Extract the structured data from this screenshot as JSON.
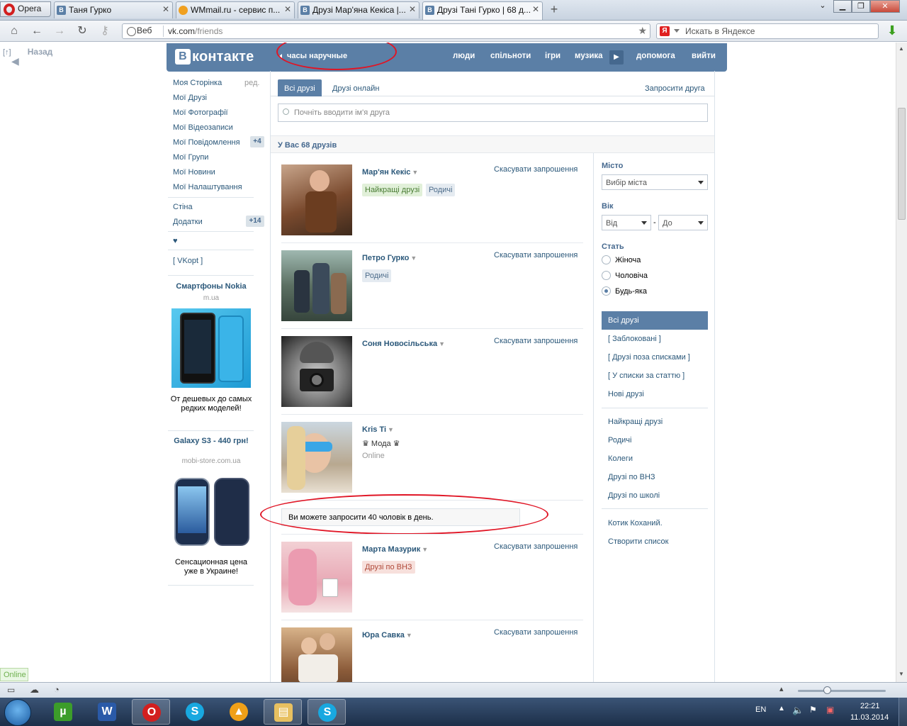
{
  "browser": {
    "menu_label": "Opera",
    "tabs": [
      {
        "title": "Таня Гурко",
        "favicon": "В"
      },
      {
        "title": "WMmail.ru - сервис п...",
        "favicon": "W"
      },
      {
        "title": "Друзі Мар'яна Кекіса |...",
        "favicon": "В"
      },
      {
        "title": "Друзі Тані Гурко | 68 д...",
        "favicon": "В"
      }
    ],
    "new_tab": "+",
    "address": {
      "mode": "Веб",
      "domain": "vk.com",
      "path": "/friends"
    },
    "search_placeholder": "Искать в Яндексе",
    "yandex": "Я",
    "status_online": "Online"
  },
  "page": {
    "back_link": "Назад",
    "back_icon": "[↑]",
    "header": {
      "logo_box": "В",
      "logo_text": "контакте",
      "status": "часы наручные",
      "nav": [
        "люди",
        "спільноти",
        "ігри",
        "музика",
        "допомога",
        "вийти"
      ]
    },
    "left_menu": {
      "items": [
        "Моя Сторінка",
        "Мої Друзі",
        "Мої Фотографії",
        "Мої Відеозаписи",
        "Мої Повідомлення",
        "Мої Групи",
        "Мої Новини",
        "Мої Налаштування"
      ],
      "edit_label": "ред.",
      "messages_badge": "+4",
      "items2": [
        "Стіна",
        "Додатки"
      ],
      "apps_badge": "+14",
      "heart": "♥",
      "vkopt": "[ VKopt ]"
    },
    "ads": [
      {
        "title": "Смартфоны Nokia",
        "domain": "m.ua",
        "text": "От дешевых до самых редких моделей!"
      },
      {
        "title": "Galaxy S3 - 440 грн!",
        "domain": "mobi-store.com.ua",
        "text": "Сенсационная цена уже в Украине!"
      }
    ],
    "friends": {
      "tabs": {
        "all": "Всі друзі",
        "online": "Друзі онлайн",
        "invite": "Запросити друга"
      },
      "search_placeholder": "Почніть вводити ім'я друга",
      "count_label": "У Вас 68 друзів",
      "cancel_label": "Скасувати запрошення",
      "list": [
        {
          "name": "Мар'ян Кекіс",
          "tags": [
            "Найкращі друзі",
            "Родичі"
          ]
        },
        {
          "name": "Петро Гурко",
          "tags": [
            "Родичі"
          ]
        },
        {
          "name": "Соня Новосільська",
          "tags": []
        },
        {
          "name": "Kris Ti",
          "sub": "♛ Мода ♛",
          "online": "Online"
        },
        {
          "name": "Марта Мазурик",
          "tags": [
            "Друзі по ВНЗ"
          ]
        },
        {
          "name": "Юра Савка",
          "tags": []
        }
      ],
      "limit_notice": "Ви можете запросити 40 чоловік в день."
    },
    "filters": {
      "city_label": "Місто",
      "city_select": "Вибір міста",
      "age_label": "Вік",
      "age_from": "Від",
      "age_dash": "-",
      "age_to": "До",
      "sex_label": "Стать",
      "sex_options": [
        "Жіноча",
        "Чоловіча",
        "Будь-яка"
      ],
      "sex_selected": "Будь-яка",
      "lists": [
        "Всі друзі",
        "[ Заблоковані ]",
        "[ Друзі поза списками ]",
        "[ У списки за статтю ]",
        "Нові друзі"
      ],
      "lists2": [
        "Найкращі друзі",
        "Родичі",
        "Колеги",
        "Друзі по ВНЗ",
        "Друзі по школі"
      ],
      "lists3": [
        "Котик Коханий.",
        "Створити список"
      ]
    }
  },
  "taskbar": {
    "lang": "EN",
    "time": "22:21",
    "date": "11.03.2014"
  },
  "colors": {
    "vk_blue": "#5b7fa6",
    "link": "#2b587a",
    "annotation_red": "#e01525"
  }
}
